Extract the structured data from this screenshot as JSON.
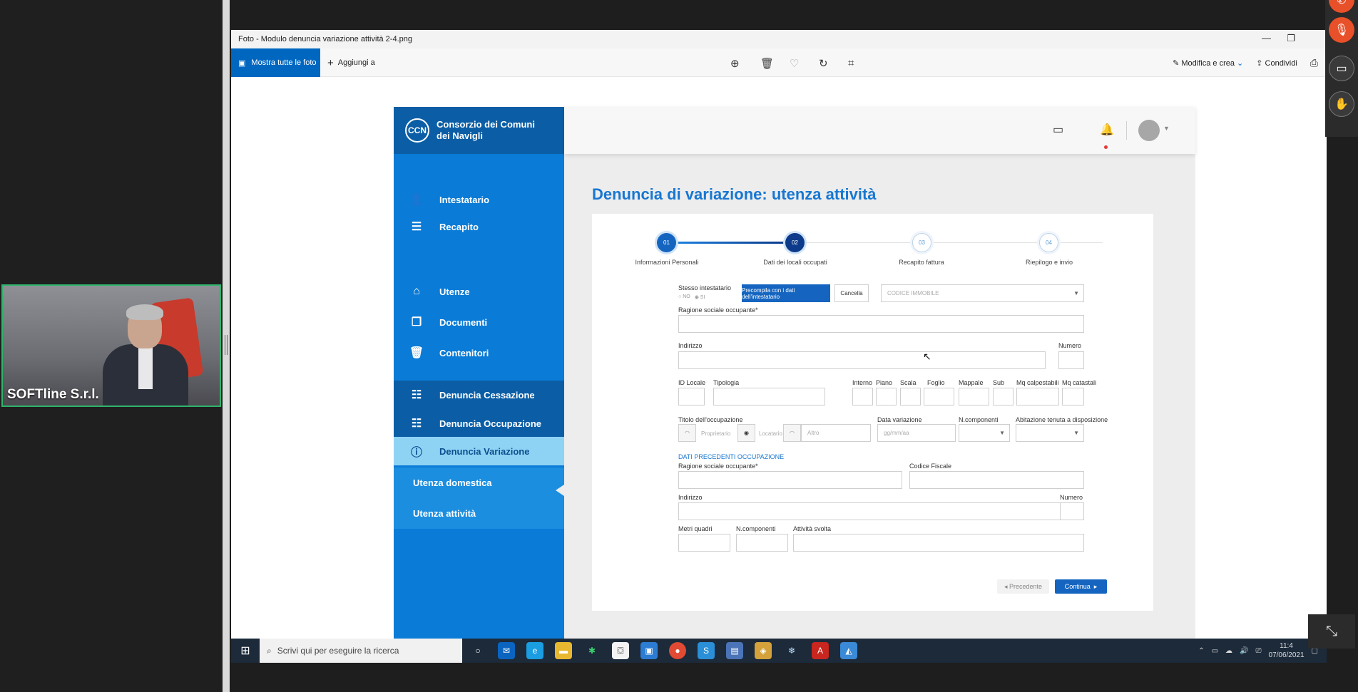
{
  "meeting": {
    "participant_name": "SOFTline S.r.l."
  },
  "photos": {
    "window_title": "Foto - Modulo denuncia variazione attività 2-4.png",
    "show_all_label": "Mostra tutte le foto",
    "add_to_label": "Aggiungi a",
    "edit_create_label": "Modifica e crea",
    "share_label": "Condividi"
  },
  "app": {
    "logo_initials": "CCN",
    "logo_name_line1": "Consorzio dei Comuni",
    "logo_name_line2": "dei Navigli",
    "nav": [
      {
        "label": "Intestatario",
        "icon": "user-icon"
      },
      {
        "label": "Recapito",
        "icon": "list-icon"
      },
      {
        "label": "Utenze",
        "icon": "home-icon"
      },
      {
        "label": "Documenti",
        "icon": "documents-icon"
      },
      {
        "label": "Contenitori",
        "icon": "trash-bin-icon"
      },
      {
        "label": "Denuncia Cessazione",
        "icon": "sliders-icon"
      },
      {
        "label": "Denuncia Occupazione",
        "icon": "sliders-icon"
      },
      {
        "label": "Denuncia Variazione",
        "icon": "info-icon"
      },
      {
        "label": "Utenza domestica"
      },
      {
        "label": "Utenza attività"
      }
    ]
  },
  "page": {
    "title": "Denuncia di variazione: utenza attività",
    "steps": [
      {
        "num": "01",
        "label": "Informazioni Personali"
      },
      {
        "num": "02",
        "label": "Dati dei locali occupati"
      },
      {
        "num": "03",
        "label": "Recapito fattura"
      },
      {
        "num": "04",
        "label": "Riepilogo e invio"
      }
    ],
    "form": {
      "stesso_intestatario": "Stesso intestatario",
      "radio_no": "NO",
      "radio_si": "SI",
      "precompila_btn": "Precompila con i dati dell'intestatario",
      "cancella_btn": "Cancella",
      "codice_immobile_ph": "CODICE IMMOBILE",
      "ragione_sociale": "Ragione sociale occupante*",
      "indirizzo": "Indirizzo",
      "numero": "Numero",
      "id_locale": "ID Locale",
      "tipologia": "Tipologia",
      "interno": "Interno",
      "piano": "Piano",
      "scala": "Scala",
      "foglio": "Foglio",
      "mappale": "Mappale",
      "sub": "Sub",
      "mq_calpestabili": "Mq calpestabili",
      "mq_catastali": "Mq catastali",
      "titolo_occupazione": "Titolo dell'occupazione",
      "proprietario": "Proprietario",
      "locatario": "Locatario",
      "altro_ph": "Altro",
      "data_variazione": "Data variazione",
      "date_ph": "gg/mm/aa",
      "n_componenti": "N.componenti",
      "abitazione": "Abitazione tenuta a disposizione",
      "dati_precedenti": "DATI PRECEDENTI OCCUPAZIONE",
      "prev_ragione_sociale": "Ragione sociale occupante*",
      "codice_fiscale": "Codice Fiscale",
      "prev_indirizzo": "Indirizzo",
      "prev_numero": "Numero",
      "metri_quadri": "Metri quadri",
      "prev_n_componenti": "N.componenti",
      "attivita_svolta": "Attività svolta",
      "precedente_btn": "Precedente",
      "continua_btn": "Continua"
    }
  },
  "taskbar": {
    "search_placeholder": "Scrivi qui per eseguire la ricerca",
    "time": "11:4",
    "date": "07/06/2021"
  },
  "colors": {
    "sidebar": "#0a7bd6",
    "sidebar_dark": "#0b5ea6",
    "accent": "#1565c0",
    "active_item": "#8fd3f4"
  }
}
